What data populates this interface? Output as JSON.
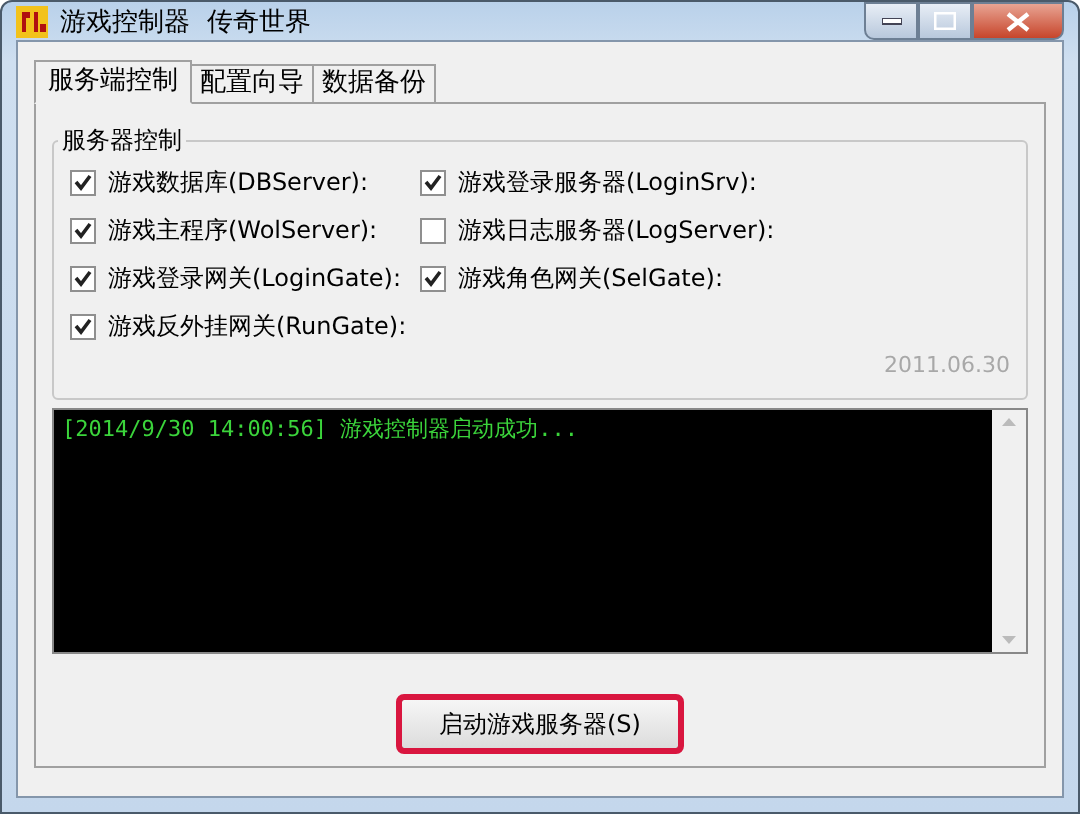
{
  "window": {
    "title": "游戏控制器  传奇世界"
  },
  "tabs": [
    {
      "label": "服务端控制",
      "selected": true
    },
    {
      "label": "配置向导",
      "selected": false
    },
    {
      "label": "数据备份",
      "selected": false
    }
  ],
  "group": {
    "title": "服务器控制",
    "checkboxes": [
      {
        "label": "游戏数据库(DBServer):",
        "checked": true
      },
      {
        "label": "游戏登录服务器(LoginSrv):",
        "checked": true
      },
      {
        "label": "游戏主程序(WolServer):",
        "checked": true
      },
      {
        "label": "游戏日志服务器(LogServer):",
        "checked": false
      },
      {
        "label": "游戏登录网关(LoginGate):",
        "checked": true
      },
      {
        "label": "游戏角色网关(SelGate):",
        "checked": true
      },
      {
        "label": "游戏反外挂网关(RunGate):",
        "checked": true
      }
    ],
    "version": "2011.06.30"
  },
  "log": {
    "lines": [
      "[2014/9/30 14:00:56] 游戏控制器启动成功..."
    ]
  },
  "button": {
    "label": "启动游戏服务器(S)",
    "highlighted": true
  }
}
